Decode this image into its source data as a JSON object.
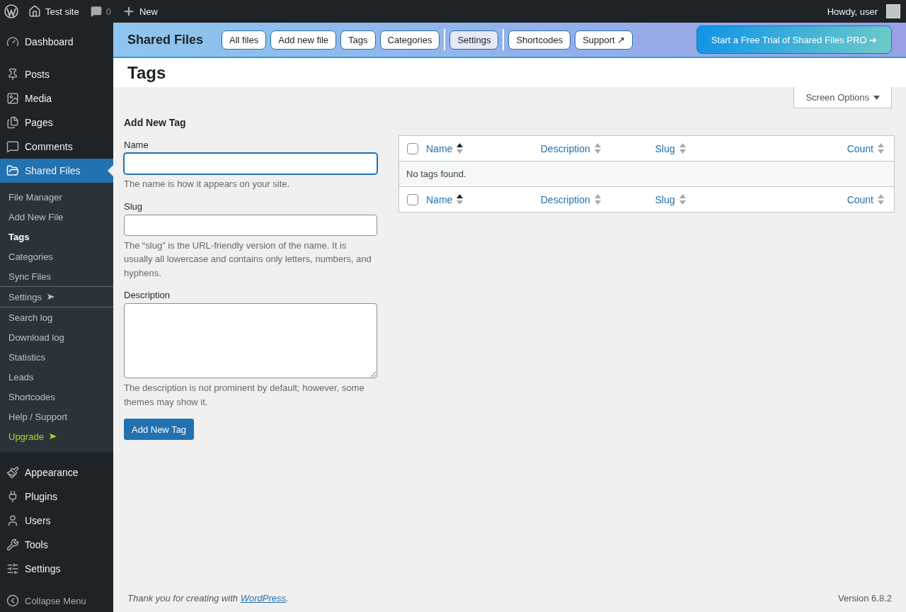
{
  "admin_bar": {
    "site": "Test site",
    "comments": "0",
    "new": "New",
    "greeting": "Howdy, user"
  },
  "sidebar": {
    "groups": [
      [
        {
          "label": "Dashboard",
          "selected": false
        }
      ],
      [
        {
          "label": "Posts",
          "selected": false
        },
        {
          "label": "Media",
          "selected": false
        },
        {
          "label": "Pages",
          "selected": false
        },
        {
          "label": "Comments",
          "selected": false
        },
        {
          "label": "Shared Files",
          "selected": true,
          "children": [
            {
              "label": "File Manager",
              "selected": false,
              "kind": "link"
            },
            {
              "label": "Add New File",
              "selected": false,
              "kind": "link"
            },
            {
              "label": "Tags",
              "selected": true,
              "kind": "link"
            },
            {
              "label": "Categories",
              "selected": false,
              "kind": "link"
            },
            {
              "label": "Sync Files",
              "selected": false,
              "kind": "link"
            },
            {
              "label": "Settings",
              "selected": false,
              "kind": "section"
            },
            {
              "label": "Search log",
              "selected": false,
              "kind": "link"
            },
            {
              "label": "Download log",
              "selected": false,
              "kind": "link"
            },
            {
              "label": "Statistics",
              "selected": false,
              "kind": "link"
            },
            {
              "label": "Leads",
              "selected": false,
              "kind": "link"
            },
            {
              "label": "Shortcodes",
              "selected": false,
              "kind": "link"
            },
            {
              "label": "Help / Support",
              "selected": false,
              "kind": "link"
            },
            {
              "label": "Upgrade",
              "selected": false,
              "kind": "upgrade"
            }
          ]
        }
      ],
      [
        {
          "label": "Appearance",
          "selected": false
        },
        {
          "label": "Plugins",
          "selected": false
        },
        {
          "label": "Users",
          "selected": false
        },
        {
          "label": "Tools",
          "selected": false
        },
        {
          "label": "Settings",
          "selected": false
        }
      ]
    ],
    "collapse": "Collapse Menu"
  },
  "plugin_header": {
    "title": "Shared Files",
    "nav_groups": [
      [
        {
          "label": "All files",
          "selected": false
        },
        {
          "label": "Add new file",
          "selected": false
        },
        {
          "label": "Tags",
          "selected": false
        },
        {
          "label": "Categories",
          "selected": false
        }
      ],
      [
        {
          "label": "Settings",
          "selected": true
        }
      ],
      [
        {
          "label": "Shortcodes",
          "selected": false
        },
        {
          "label": "Support ↗",
          "selected": false
        }
      ]
    ],
    "promo": "Start a Free Trial of Shared Files PRO ➜"
  },
  "page_title": "Tags",
  "screen_options": "Screen Options",
  "form": {
    "heading": "Add New Tag",
    "fields": [
      {
        "kind": "input",
        "label": "Name",
        "focused": true,
        "hint": "The name is how it appears on your site."
      },
      {
        "kind": "input",
        "label": "Slug",
        "focused": false,
        "hint": "The “slug” is the URL-friendly version of the name. It is usually all lowercase and contains only letters, numbers, and hyphens."
      },
      {
        "kind": "textarea",
        "label": "Description",
        "focused": false,
        "hint": "The description is not prominent by default; however, some themes may show it."
      }
    ],
    "submit": "Add New Tag"
  },
  "table": {
    "header_checked": false,
    "footer_checked": false,
    "columns": [
      {
        "label": "Name",
        "sorted": true
      },
      {
        "label": "Description",
        "sorted": false
      },
      {
        "label": "Slug",
        "sorted": false
      },
      {
        "label": "Count",
        "sorted": false
      }
    ],
    "footer_columns": [
      {
        "label": "Name",
        "sorted": true
      },
      {
        "label": "Description",
        "sorted": false
      },
      {
        "label": "Slug",
        "sorted": false
      },
      {
        "label": "Count",
        "sorted": false
      }
    ],
    "empty_message": "No tags found."
  },
  "footer": {
    "thanks": "Thank you for creating with ",
    "link": "WordPress",
    "after": ".",
    "version": "Version 6.8.2"
  }
}
